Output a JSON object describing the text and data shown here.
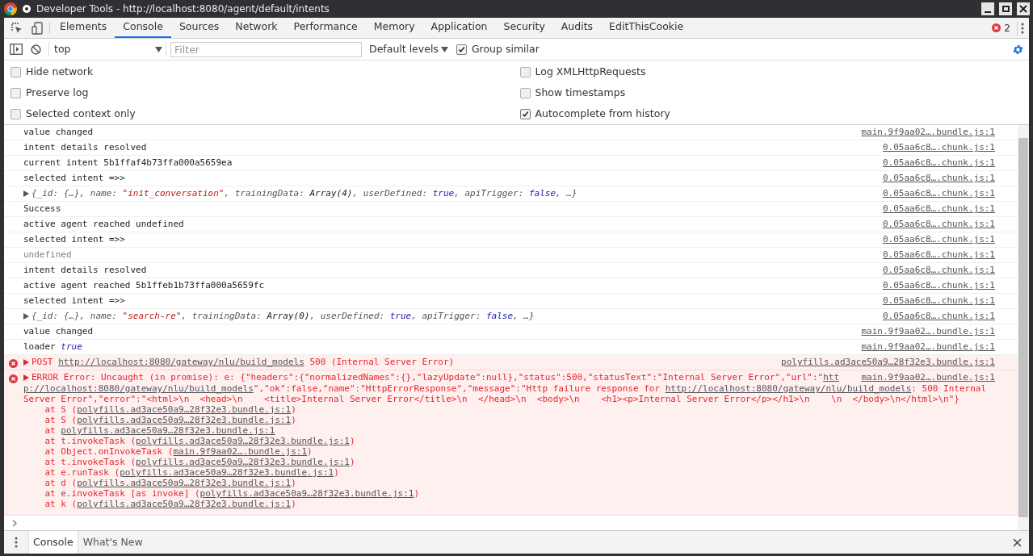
{
  "window": {
    "title": "Developer Tools - http://localhost:8080/agent/default/intents"
  },
  "tabs": [
    {
      "label": "Elements",
      "selected": false
    },
    {
      "label": "Console",
      "selected": true
    },
    {
      "label": "Sources",
      "selected": false
    },
    {
      "label": "Network",
      "selected": false
    },
    {
      "label": "Performance",
      "selected": false
    },
    {
      "label": "Memory",
      "selected": false
    },
    {
      "label": "Application",
      "selected": false
    },
    {
      "label": "Security",
      "selected": false
    },
    {
      "label": "Audits",
      "selected": false
    },
    {
      "label": "EditThisCookie",
      "selected": false
    }
  ],
  "error_count": "2",
  "toolbar": {
    "context": "top",
    "filter": {
      "placeholder": "Filter"
    },
    "levels": "Default levels",
    "group_similar": {
      "label": "Group similar",
      "checked": true
    }
  },
  "settings_left": [
    {
      "label": "Hide network",
      "checked": false
    },
    {
      "label": "Preserve log",
      "checked": false
    },
    {
      "label": "Selected context only",
      "checked": false
    }
  ],
  "settings_right": [
    {
      "label": "Log XMLHttpRequests",
      "checked": false
    },
    {
      "label": "Show timestamps",
      "checked": false
    },
    {
      "label": "Autocomplete from history",
      "checked": true
    }
  ],
  "messages": [
    {
      "kind": "info",
      "lines": [
        [
          {
            "text": "value changed",
            "kind": "plain"
          }
        ]
      ],
      "source": "main.9f9aa02….bundle.js:1"
    },
    {
      "kind": "info",
      "lines": [
        [
          {
            "text": "intent details resolved",
            "kind": "plain"
          }
        ]
      ],
      "source": "0.05aa6c8….chunk.js:1"
    },
    {
      "kind": "info",
      "lines": [
        [
          {
            "text": "current intent 5b1ffaf4b73ffa000a5659ea",
            "kind": "plain"
          }
        ]
      ],
      "source": "0.05aa6c8….chunk.js:1"
    },
    {
      "kind": "info",
      "lines": [
        [
          {
            "text": "selected intent =>>",
            "kind": "plain"
          }
        ]
      ],
      "source": "0.05aa6c8….chunk.js:1"
    },
    {
      "kind": "info",
      "expanded": false,
      "lines": [
        [
          {
            "text": "{_id: {…}, name: ",
            "kind": "prop"
          },
          {
            "text": "\"init_conversation\"",
            "kind": "string"
          },
          {
            "text": ", trainingData: ",
            "kind": "prop"
          },
          {
            "text": "Array(4)",
            "kind": "value"
          },
          {
            "text": ", userDefined: ",
            "kind": "prop"
          },
          {
            "text": "true",
            "kind": "keyword"
          },
          {
            "text": ", apiTrigger: ",
            "kind": "prop"
          },
          {
            "text": "false",
            "kind": "keyword"
          },
          {
            "text": ", …}",
            "kind": "prop"
          }
        ]
      ],
      "source": "0.05aa6c8….chunk.js:1"
    },
    {
      "kind": "info",
      "lines": [
        [
          {
            "text": "Success",
            "kind": "plain"
          }
        ]
      ],
      "source": "0.05aa6c8….chunk.js:1"
    },
    {
      "kind": "info",
      "lines": [
        [
          {
            "text": "active agent reached undefined",
            "kind": "plain"
          }
        ]
      ],
      "source": "0.05aa6c8….chunk.js:1"
    },
    {
      "kind": "info",
      "lines": [
        [
          {
            "text": "selected intent =>>",
            "kind": "plain"
          }
        ]
      ],
      "source": "0.05aa6c8….chunk.js:1"
    },
    {
      "kind": "info",
      "lines": [
        [
          {
            "text": "undefined",
            "kind": "muted"
          }
        ]
      ],
      "source": "0.05aa6c8….chunk.js:1"
    },
    {
      "kind": "info",
      "lines": [
        [
          {
            "text": "intent details resolved",
            "kind": "plain"
          }
        ]
      ],
      "source": "0.05aa6c8….chunk.js:1"
    },
    {
      "kind": "info",
      "lines": [
        [
          {
            "text": "active agent reached 5b1ffeb1b73ffa000a5659fc",
            "kind": "plain"
          }
        ]
      ],
      "source": "0.05aa6c8….chunk.js:1"
    },
    {
      "kind": "info",
      "lines": [
        [
          {
            "text": "selected intent =>>",
            "kind": "plain"
          }
        ]
      ],
      "source": "0.05aa6c8….chunk.js:1"
    },
    {
      "kind": "info",
      "expanded": false,
      "lines": [
        [
          {
            "text": "{_id: {…}, name: ",
            "kind": "prop"
          },
          {
            "text": "\"search-re\"",
            "kind": "string"
          },
          {
            "text": ", trainingData: ",
            "kind": "prop"
          },
          {
            "text": "Array(0)",
            "kind": "value"
          },
          {
            "text": ", userDefined: ",
            "kind": "prop"
          },
          {
            "text": "true",
            "kind": "keyword"
          },
          {
            "text": ", apiTrigger: ",
            "kind": "prop"
          },
          {
            "text": "false",
            "kind": "keyword"
          },
          {
            "text": ", …}",
            "kind": "prop"
          }
        ]
      ],
      "source": "0.05aa6c8….chunk.js:1"
    },
    {
      "kind": "info",
      "lines": [
        [
          {
            "text": "value changed",
            "kind": "plain"
          }
        ]
      ],
      "source": "main.9f9aa02….bundle.js:1"
    },
    {
      "kind": "info",
      "lines": [
        [
          {
            "text": "loader ",
            "kind": "plain"
          },
          {
            "text": "true",
            "kind": "keyword"
          }
        ]
      ],
      "source": "main.9f9aa02….bundle.js:1"
    },
    {
      "kind": "error",
      "expanded": false,
      "lines": [
        [
          {
            "text": "POST ",
            "kind": "plain"
          },
          {
            "text": "http://localhost:8080/gateway/nlu/build_models",
            "kind": "link"
          },
          {
            "text": " 500 (Internal Server Error)",
            "kind": "plain"
          }
        ]
      ],
      "source": "polyfills.ad3ace50a9…28f32e3.bundle.js:1"
    },
    {
      "kind": "error",
      "expanded": false,
      "lines": [
        [
          {
            "text": "ERROR Error: Uncaught (in promise): e: {\"headers\":{\"normalizedNames\":{},\"lazyUpdate\":null},\"status\":500,\"statusText\":\"Internal Server Error\",\"url\":\"",
            "kind": "plain"
          },
          {
            "text": "htt",
            "kind": "link"
          }
        ],
        [
          {
            "text": "p://localhost:8080/gateway/nlu/build_models",
            "kind": "link"
          },
          {
            "text": "\",\"ok\":false,\"name\":\"HttpErrorResponse\",\"message\":\"Http failure response for ",
            "kind": "plain"
          },
          {
            "text": "http://localhost:8080/gateway/nlu/build_models",
            "kind": "link"
          },
          {
            "text": ": 500 Internal",
            "kind": "plain"
          }
        ],
        [
          {
            "text": "Server Error\",\"error\":\"<html>\\n  <head>\\n    <title>Internal Server Error</title>\\n  </head>\\n  <body>\\n    <h1><p>Internal Server Error</p></h1>\\n    \\n  </body>\\n</html>\\n\"}",
            "kind": "plain"
          }
        ],
        [
          {
            "text": "    at S (",
            "kind": "plain"
          },
          {
            "text": "polyfills.ad3ace50a9…28f32e3.bundle.js:1",
            "kind": "link"
          },
          {
            "text": ")",
            "kind": "plain"
          }
        ],
        [
          {
            "text": "    at S (",
            "kind": "plain"
          },
          {
            "text": "polyfills.ad3ace50a9…28f32e3.bundle.js:1",
            "kind": "link"
          },
          {
            "text": ")",
            "kind": "plain"
          }
        ],
        [
          {
            "text": "    at ",
            "kind": "plain"
          },
          {
            "text": "polyfills.ad3ace50a9…28f32e3.bundle.js:1",
            "kind": "link"
          }
        ],
        [
          {
            "text": "    at t.invokeTask (",
            "kind": "plain"
          },
          {
            "text": "polyfills.ad3ace50a9…28f32e3.bundle.js:1",
            "kind": "link"
          },
          {
            "text": ")",
            "kind": "plain"
          }
        ],
        [
          {
            "text": "    at Object.onInvokeTask (",
            "kind": "plain"
          },
          {
            "text": "main.9f9aa02….bundle.js:1",
            "kind": "link"
          },
          {
            "text": ")",
            "kind": "plain"
          }
        ],
        [
          {
            "text": "    at t.invokeTask (",
            "kind": "plain"
          },
          {
            "text": "polyfills.ad3ace50a9…28f32e3.bundle.js:1",
            "kind": "link"
          },
          {
            "text": ")",
            "kind": "plain"
          }
        ],
        [
          {
            "text": "    at e.runTask (",
            "kind": "plain"
          },
          {
            "text": "polyfills.ad3ace50a9…28f32e3.bundle.js:1",
            "kind": "link"
          },
          {
            "text": ")",
            "kind": "plain"
          }
        ],
        [
          {
            "text": "    at d (",
            "kind": "plain"
          },
          {
            "text": "polyfills.ad3ace50a9…28f32e3.bundle.js:1",
            "kind": "link"
          },
          {
            "text": ")",
            "kind": "plain"
          }
        ],
        [
          {
            "text": "    at e.invokeTask [as invoke] (",
            "kind": "plain"
          },
          {
            "text": "polyfills.ad3ace50a9…28f32e3.bundle.js:1",
            "kind": "link"
          },
          {
            "text": ")",
            "kind": "plain"
          }
        ],
        [
          {
            "text": "    at k (",
            "kind": "plain"
          },
          {
            "text": "polyfills.ad3ace50a9…28f32e3.bundle.js:1",
            "kind": "link"
          },
          {
            "text": ")",
            "kind": "plain"
          }
        ]
      ],
      "source": "main.9f9aa02….bundle.js:1"
    }
  ],
  "drawer_tabs": [
    {
      "label": "Console",
      "selected": true
    },
    {
      "label": "What's New",
      "selected": false
    }
  ]
}
